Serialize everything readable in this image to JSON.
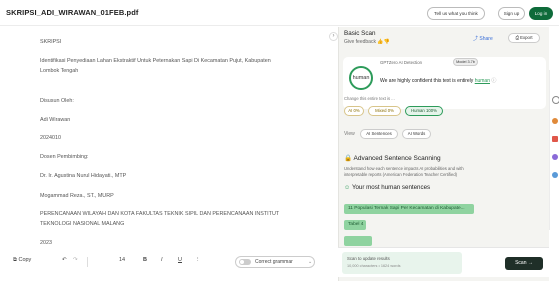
{
  "topbar": {
    "file_name": "SKRIPSI_ADI_WIRAWAN_01FEB.pdf",
    "feedback_label": "Tell us what you think",
    "signup_label": "Sign up",
    "login_label": "Log in"
  },
  "document": {
    "lines": [
      "SKRIPSI",
      "Identifikasi Penyediaan Lahan Ekstraktif Untuk Peternakan Sapi Di Kecamatan Pujut, Kabupaten",
      "Lombok Tengah",
      "Disusun Oleh:",
      "Adi Wirawan",
      "2024010",
      "Dosen Pembimbing:",
      "Dr. Ir. Agustina Nurul Hidayati., MTP",
      "Mogammad Reza., ST., MURP",
      "PERENCANAAN WILAYAH DAN KOTA FAKULTAS TEKNIK SIPIL DAN PERENCANAAN INSTITUT",
      "TEKNOLOGI NASIONAL MALANG",
      "2023"
    ]
  },
  "toolbar": {
    "copy_label": "Copy",
    "undo_icon": "undo-icon",
    "redo_icon": "redo-icon",
    "font_size": "14",
    "bold_label": "B",
    "italic_label": "I",
    "underline_label": "U",
    "more_label": "⋮",
    "grammar_label": "Correct grammar"
  },
  "panel": {
    "title": "Basic Scan",
    "feedback_prompt": "Give feedback",
    "share_label": "Share",
    "export_label": "Export",
    "detection_label": "GPTZero AI Detection",
    "model_badge": "Model 3.7b",
    "result_circle": "human",
    "result_text_prefix": "We are highly confident this text is entirely",
    "result_text_word": "human",
    "change_prompt": "Change this entire text is ...",
    "pills": [
      "AI 0%",
      "Mixed 0%",
      "Human 100%"
    ],
    "view_label": "View",
    "view_buttons": [
      "AI Sentences",
      "AI Words"
    ],
    "advanced_title": "Advanced Sentence Scanning",
    "advanced_desc_1": "Understand how each sentence impacts AI probabilities and with",
    "advanced_desc_2": "interpretable reports (American Federation Teacher Certified)",
    "human_sentences_title": "Your most human sentences",
    "highlights": [
      "11 Populasi Ternak Sapi Per Kecamatan di Kabupate...",
      "Tabel 4",
      ""
    ],
    "update_title": "Scan to update results",
    "update_sub": "10,000 characters • 1624 words",
    "scan_label": "Scan →"
  },
  "colors": {
    "brand_green": "#0e6b3a",
    "human_green": "#2d9b5a",
    "highlight": "#8fd3a0"
  }
}
